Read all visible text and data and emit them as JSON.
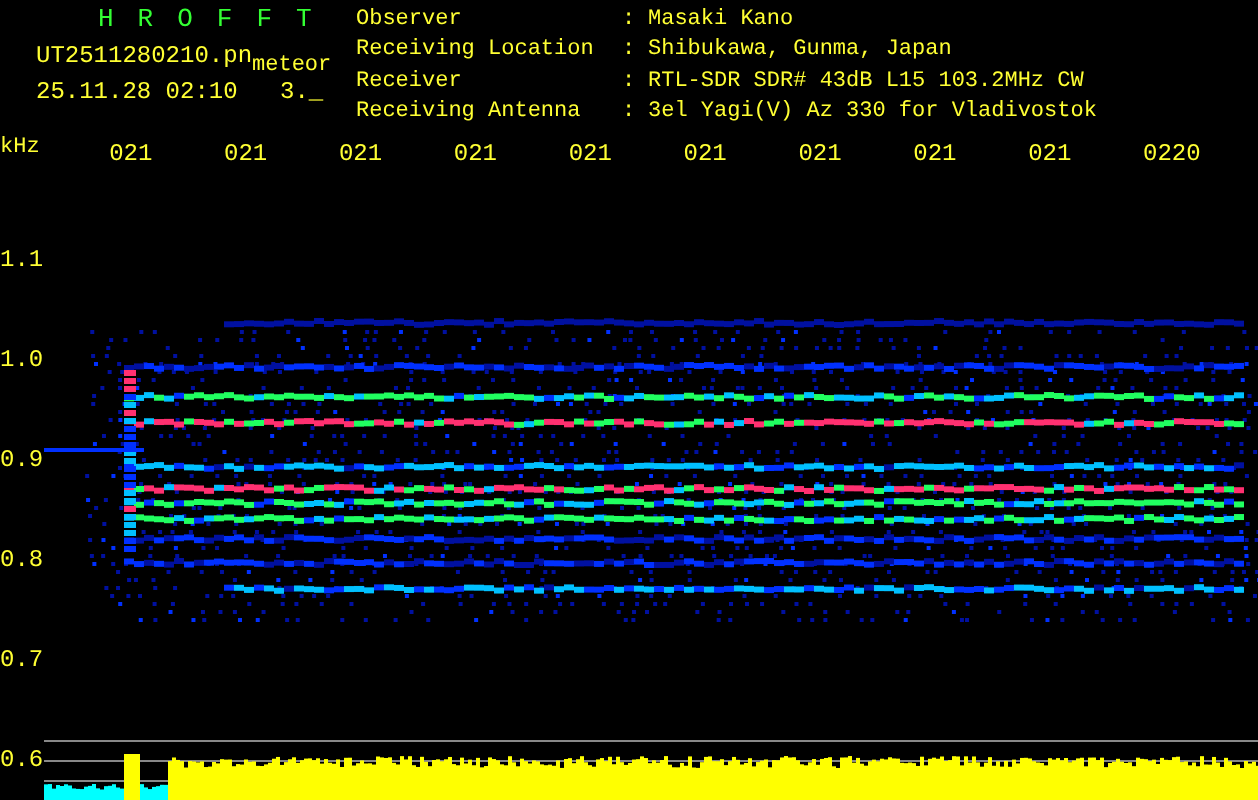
{
  "app_title": "HROFFT",
  "file_name": "UT2511280210.pn",
  "event_type": "meteor",
  "timestamp": "25.11.28 02:10",
  "count": "3._",
  "info": [
    {
      "label": "Observer",
      "separator": ":",
      "value": "Masaki Kano"
    },
    {
      "label": "Receiving Location",
      "separator": ":",
      "value": "Shibukawa, Gunma, Japan"
    },
    {
      "label": "Receiver",
      "separator": ":",
      "value": "RTL-SDR SDR# 43dB L15 103.2MHz CW"
    },
    {
      "label": "Receiving Antenna",
      "separator": ":",
      "value": "3el Yagi(V) Az 330 for Vladivostok"
    }
  ],
  "frequency_axis": {
    "unit": "kHz",
    "labels": [
      "1.1",
      "1.0",
      "0.9",
      "0.8",
      "0.7",
      "0.6"
    ]
  },
  "time_axis": {
    "labels": [
      "021",
      "021",
      "021",
      "021",
      "021",
      "021",
      "021",
      "021",
      "021",
      "0220"
    ]
  }
}
